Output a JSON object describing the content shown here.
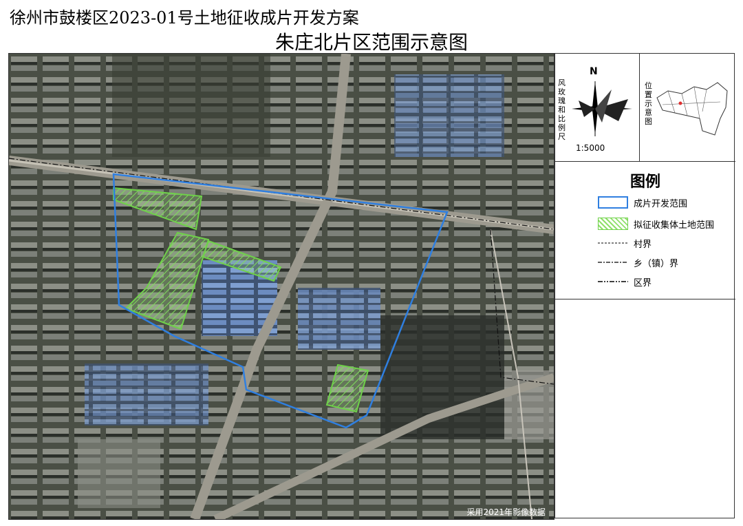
{
  "header": {
    "title": "徐州市鼓楼区2023-01号土地征收成片开发方案",
    "subtitle": "朱庄北片区范围示意图"
  },
  "compass": {
    "north": "N",
    "label": "风玫瑰和比例尺",
    "scale": "1:5000"
  },
  "location_map": {
    "label": "位置示意图"
  },
  "legend": {
    "title": "图例",
    "items": [
      {
        "label": "成片开发范围",
        "symbol": "blue-outline-box",
        "color": "#2f7fe0"
      },
      {
        "label": "拟征收集体土地范围",
        "symbol": "green-hatched-box",
        "color": "#6fd14a"
      },
      {
        "label": "村界",
        "symbol": "dashed-line"
      },
      {
        "label": "乡（镇）界",
        "symbol": "dash-dot-line"
      },
      {
        "label": "区界",
        "symbol": "dash-dot-dot-line"
      }
    ]
  },
  "map": {
    "credit": "采用2021年影像数据",
    "boundary_color": "#2f7fe0",
    "collective_land_color": "#6fd14a"
  }
}
